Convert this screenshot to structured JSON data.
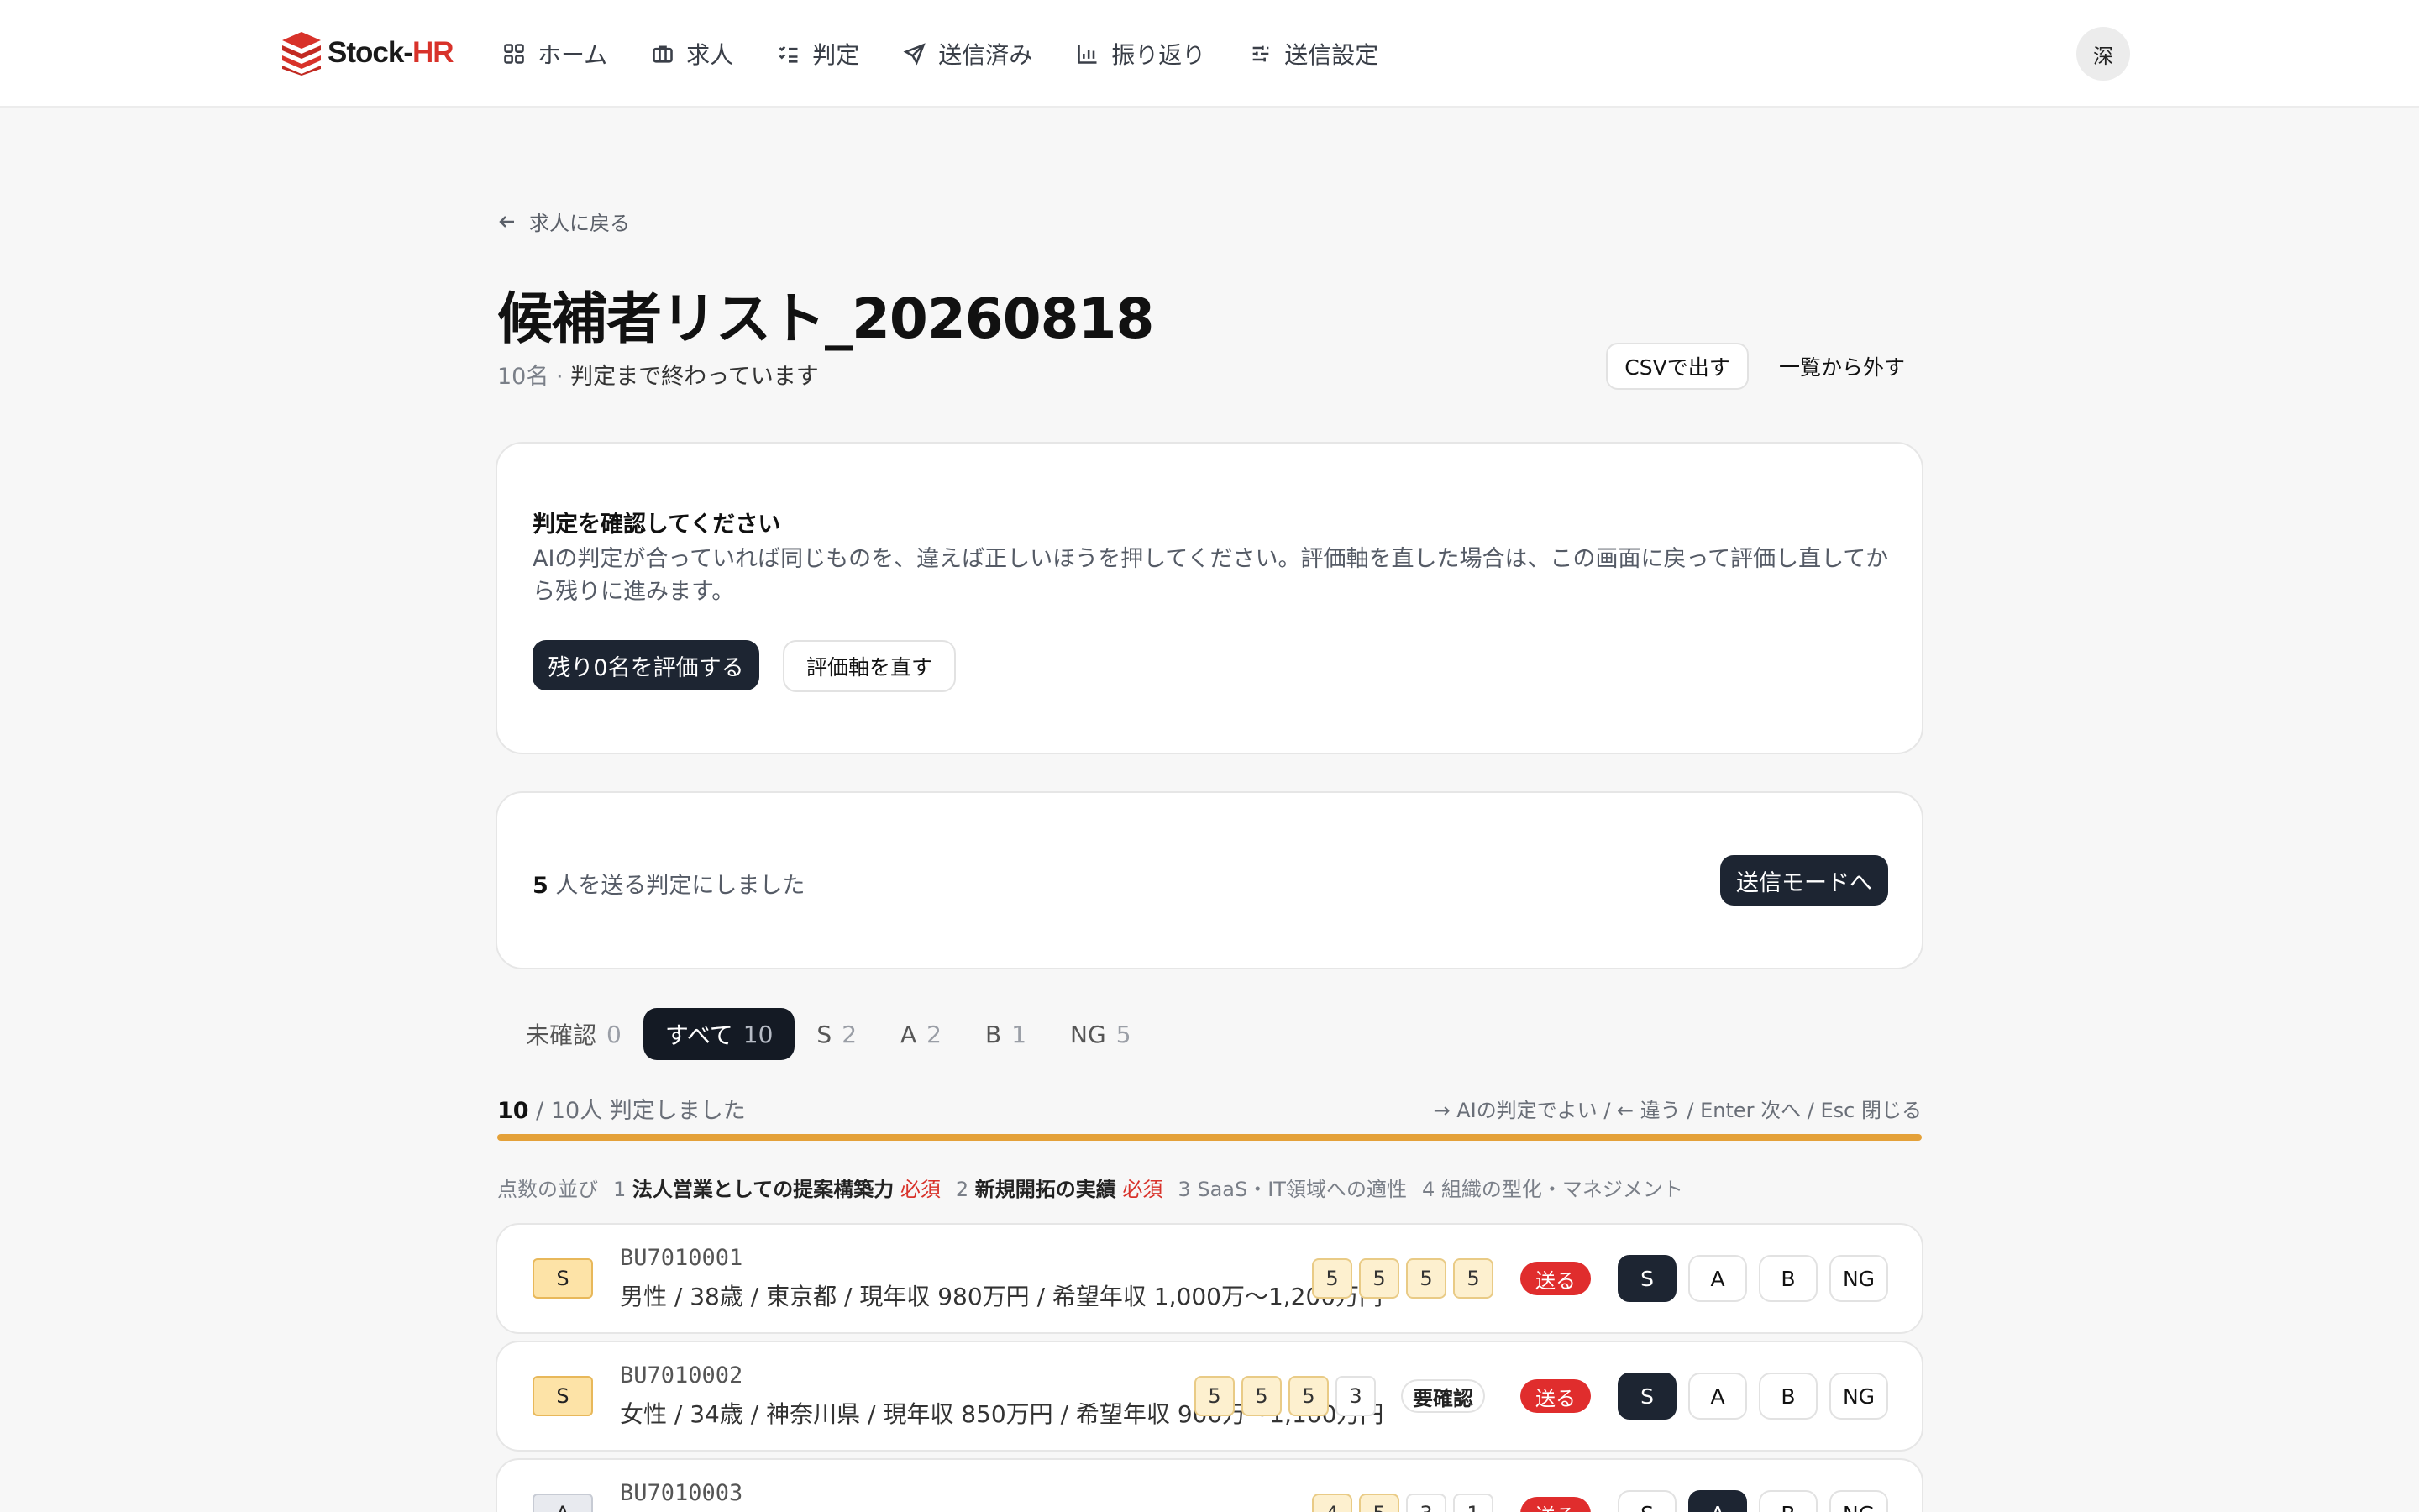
{
  "brand": {
    "name_main": "Stock-",
    "name_accent": "HR"
  },
  "nav": [
    {
      "label": "ホーム",
      "icon": "grid-icon"
    },
    {
      "label": "求人",
      "icon": "briefcase-icon"
    },
    {
      "label": "判定",
      "icon": "checklist-icon"
    },
    {
      "label": "送信済み",
      "icon": "send-icon"
    },
    {
      "label": "振り返り",
      "icon": "bar-chart-icon"
    },
    {
      "label": "送信設定",
      "icon": "sliders-icon"
    }
  ],
  "user": {
    "avatar": "深"
  },
  "back_label": "求人に戻る",
  "page": {
    "title": "候補者リスト_20260818",
    "count": "10名",
    "sep": " · ",
    "status": "判定まで終わっています",
    "csv_button": "CSVで出す",
    "remove_button": "一覧から外す"
  },
  "review_card": {
    "heading": "判定を確認してください",
    "body": "AIの判定が合っていれば同じものを、違えば正しいほうを押してください。評価軸を直した場合は、この画面に戻って評価し直してから残りに進みます。",
    "evaluate_button": "残り0名を評価する",
    "edit_axes_button": "評価軸を直す"
  },
  "send_card": {
    "count": "5",
    "text": " 人を送る判定にしました",
    "button": "送信モードへ"
  },
  "tabs": [
    {
      "label": "未確認",
      "count": "0"
    },
    {
      "label": "すべて",
      "count": "10"
    },
    {
      "label": "S",
      "count": "2"
    },
    {
      "label": "A",
      "count": "2"
    },
    {
      "label": "B",
      "count": "1"
    },
    {
      "label": "NG",
      "count": "5"
    }
  ],
  "progress": {
    "done": "10",
    "rest": " / 10人 判定しました",
    "fraction": 1.0
  },
  "shortcut_hint": "→ AIの判定でよい / ← 違う / Enter 次へ / Esc 閉じる",
  "axes": {
    "label": "点数の並び",
    "items": [
      {
        "num": "1",
        "name": "法人営業としての提案構築力",
        "req": "必須"
      },
      {
        "num": "2",
        "name": "新規開拓の実績",
        "req": "必須"
      },
      {
        "num": "3",
        "name": "SaaS・IT領域への適性",
        "req": ""
      },
      {
        "num": "4",
        "name": "組織の型化・マネジメント",
        "req": ""
      }
    ]
  },
  "grade_buttons": [
    "S",
    "A",
    "B",
    "NG"
  ],
  "send_label": "送る",
  "confirm_label": "要確認",
  "candidates": [
    {
      "grade": "S",
      "id": "BU7010001",
      "desc": "男性 / 38歳 / 東京都 / 現年収 980万円 / 希望年収 1,000万〜1,200万円",
      "scores": [
        "5",
        "5",
        "5",
        "5"
      ],
      "selected": "S",
      "confirm": false
    },
    {
      "grade": "S",
      "id": "BU7010002",
      "desc": "女性 / 34歳 / 神奈川県 / 現年収 850万円 / 希望年収 900万〜1,100万円",
      "scores": [
        "5",
        "5",
        "5",
        "3"
      ],
      "selected": "S",
      "confirm": true
    },
    {
      "grade": "A",
      "id": "BU7010003",
      "desc": "",
      "scores": [
        "4",
        "5",
        "3",
        "1"
      ],
      "selected": "A",
      "confirm": false
    }
  ]
}
